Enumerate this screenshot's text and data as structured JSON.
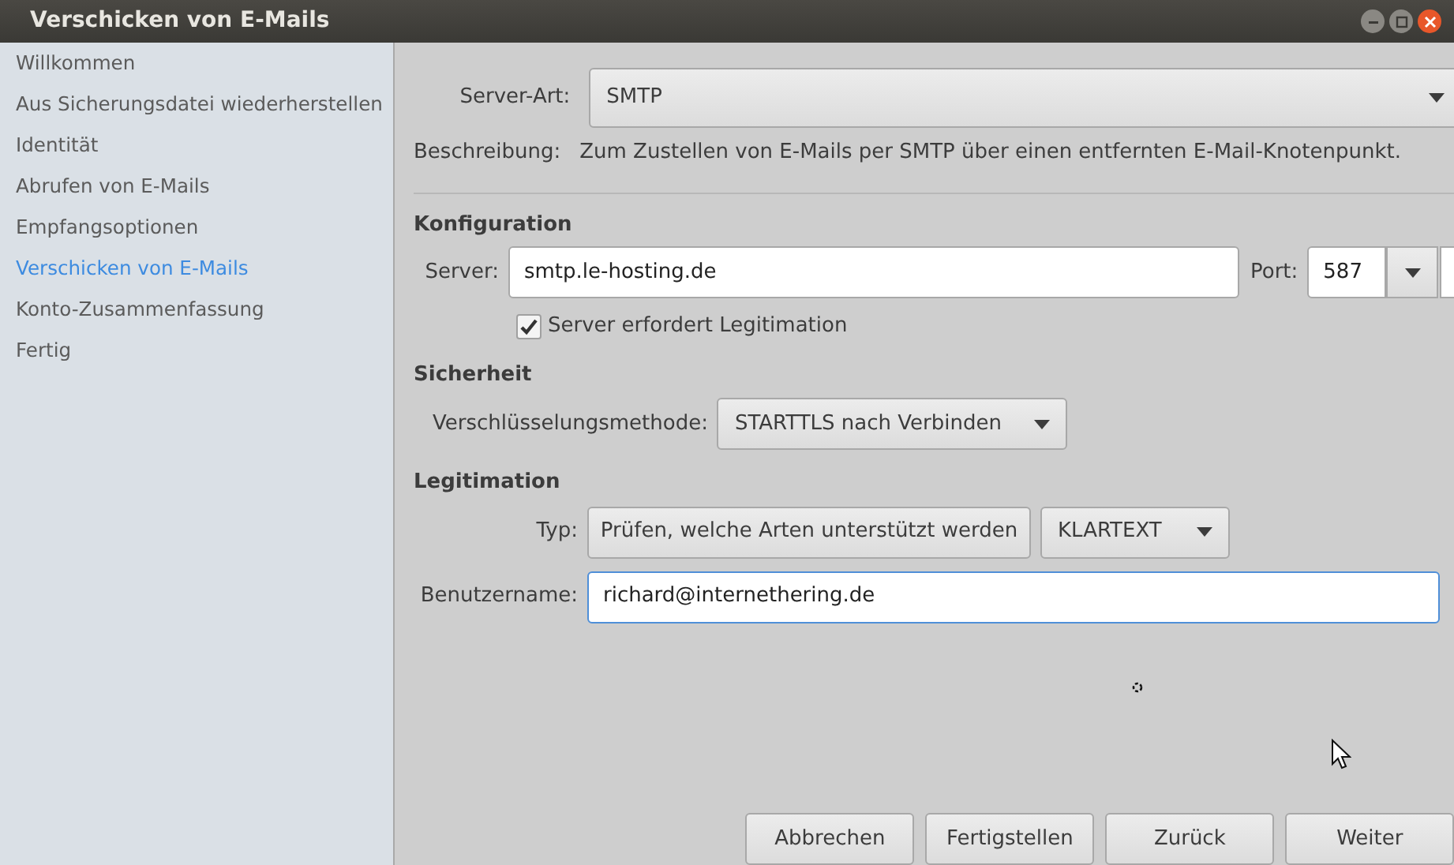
{
  "window": {
    "title": "Verschicken von E-Mails"
  },
  "sidebar": {
    "items": [
      {
        "label": "Willkommen",
        "selected": false
      },
      {
        "label": "Aus Sicherungsdatei wiederherstellen",
        "selected": false
      },
      {
        "label": "Identität",
        "selected": false
      },
      {
        "label": "Abrufen von E-Mails",
        "selected": false
      },
      {
        "label": "Empfangsoptionen",
        "selected": false
      },
      {
        "label": "Verschicken von E-Mails",
        "selected": true
      },
      {
        "label": "Konto-Zusammenfassung",
        "selected": false
      },
      {
        "label": "Fertig",
        "selected": false
      }
    ]
  },
  "server_type": {
    "label": "Server-Art:",
    "value": "SMTP"
  },
  "description": {
    "label": "Beschreibung:",
    "text": "Zum Zustellen von E-Mails per SMTP über einen entfernten E-Mail-Knotenpunkt."
  },
  "configuration": {
    "heading": "Konfiguration",
    "server_label": "Server:",
    "server_value": "smtp.le-hosting.de",
    "port_label": "Port:",
    "port_value": "587",
    "auth_checkbox": {
      "label": "Server erfordert Legitimation",
      "checked": true
    }
  },
  "security": {
    "heading": "Sicherheit",
    "encryption_label": "Verschlüsselungsmethode:",
    "encryption_value": "STARTTLS nach Verbinden"
  },
  "authentication": {
    "heading": "Legitimation",
    "type_label": "Typ:",
    "check_button": "Prüfen, welche Arten unterstützt werden",
    "type_value": "KLARTEXT",
    "username_label": "Benutzername:",
    "username_value": "richard@internethering.de",
    "username_focused": true
  },
  "buttons": [
    "Abbrechen",
    "Fertigstellen",
    "Zurück",
    "Weiter"
  ]
}
